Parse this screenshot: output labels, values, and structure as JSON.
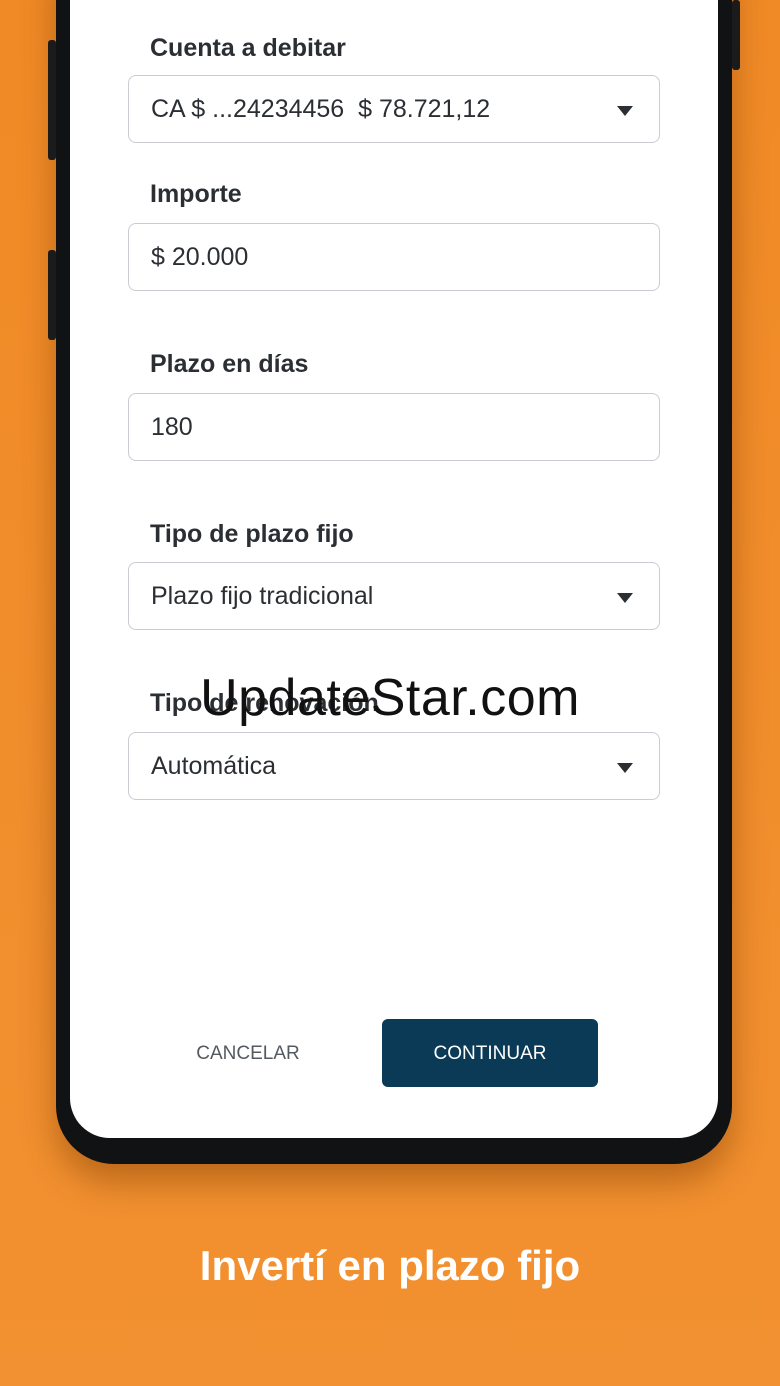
{
  "form": {
    "account": {
      "label": "Cuenta a debitar",
      "value": "CA $ ...24234456  $ 78.721,12"
    },
    "amount": {
      "label": "Importe",
      "value": "$ 20.000"
    },
    "term": {
      "label": "Plazo en días",
      "value": "180"
    },
    "type": {
      "label": "Tipo de plazo fijo",
      "value": "Plazo fijo tradicional"
    },
    "renewal": {
      "label": "Tipo de renovación",
      "value": "Automática"
    }
  },
  "actions": {
    "cancel_label": "CANCELAR",
    "continue_label": "CONTINUAR"
  },
  "watermark": "UpdateStar.com",
  "caption": "Invertí en plazo fijo",
  "icons": {
    "dropdown": "chevron-down-icon"
  },
  "colors": {
    "background": "#f08a26",
    "primary_button": "#0b3a57",
    "text": "#2b2f33",
    "field_border": "#c9cdd2"
  }
}
